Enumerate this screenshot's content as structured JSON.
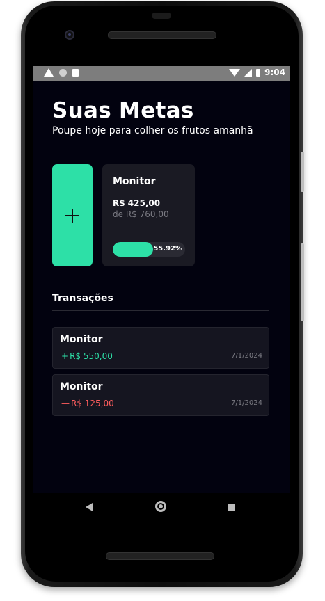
{
  "statusbar": {
    "time": "9:04"
  },
  "header": {
    "title": "Suas Metas",
    "subtitle": "Poupe hoje para colher os frutos amanhã"
  },
  "add_goal": {
    "icon": "plus-icon"
  },
  "goal": {
    "name": "Monitor",
    "saved": "R$ 425,00",
    "target": "de R$ 760,00",
    "progress_label": "55.92%",
    "progress": 0.5592
  },
  "transactions": {
    "title": "Transações",
    "items": [
      {
        "name": "Monitor",
        "sign": "+",
        "amount": "R$ 550,00",
        "date": "7/1/2024",
        "type": "income"
      },
      {
        "name": "Monitor",
        "sign": "—",
        "amount": "R$ 125,00",
        "date": "7/1/2024",
        "type": "expense"
      }
    ]
  },
  "colors": {
    "accent": "#2de0a7",
    "expense": "#ff5d5d",
    "background": "#02020f",
    "card": "#1a1a23"
  },
  "navbar": {
    "icons": [
      "back-icon",
      "home-icon",
      "recents-icon"
    ]
  }
}
